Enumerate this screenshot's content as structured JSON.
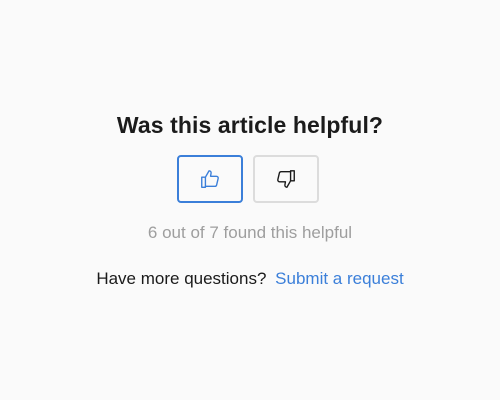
{
  "feedback": {
    "title": "Was this article helpful?",
    "upvote_icon": "thumbs-up-icon",
    "downvote_icon": "thumbs-down-icon",
    "count_text": "6 out of 7 found this helpful",
    "more_questions_text": "Have more questions?",
    "submit_link_text": "Submit a request"
  },
  "colors": {
    "accent": "#3b7fd9",
    "muted_text": "#9e9e9e",
    "border": "#dcdcdc",
    "background": "#fafafa"
  }
}
